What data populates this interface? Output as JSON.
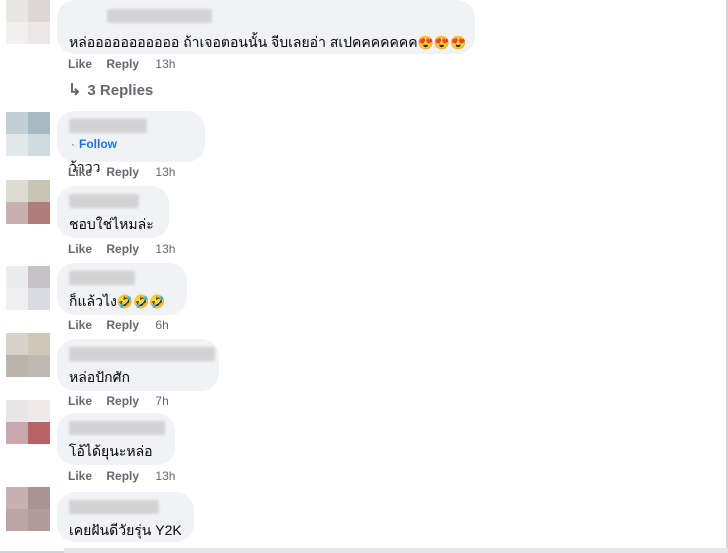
{
  "replies_label": "3 Replies",
  "follow_label": "Follow",
  "comments": [
    {
      "text": "หล่อออออออออออ ถ้าเจอตอนนั้น จีบเลยอ่า สเปคคคคคคค",
      "emojis": "😍😍😍",
      "like": "Like",
      "reply": "Reply",
      "time": "13h"
    },
    {
      "text": "ว้าวว",
      "emojis": "",
      "like": "Like",
      "reply": "Reply",
      "time": "13h"
    },
    {
      "text": "ชอบใช่ไหมล่ะ",
      "emojis": "",
      "like": "Like",
      "reply": "Reply",
      "time": "13h"
    },
    {
      "text": "ก็แล้วไง",
      "emojis": "🤣🤣🤣",
      "like": "Like",
      "reply": "Reply",
      "time": "6h"
    },
    {
      "text": "หล่อปักศัก",
      "emojis": "",
      "like": "Like",
      "reply": "Reply",
      "time": "7h"
    },
    {
      "text": "โอ้ได้ยุนะหล่อ",
      "emojis": "",
      "like": "Like",
      "reply": "Reply",
      "time": "13h"
    },
    {
      "text": "เคยฝันดีวัยรุ่น Y2K",
      "emojis": "",
      "like": "",
      "reply": "",
      "time": ""
    }
  ]
}
